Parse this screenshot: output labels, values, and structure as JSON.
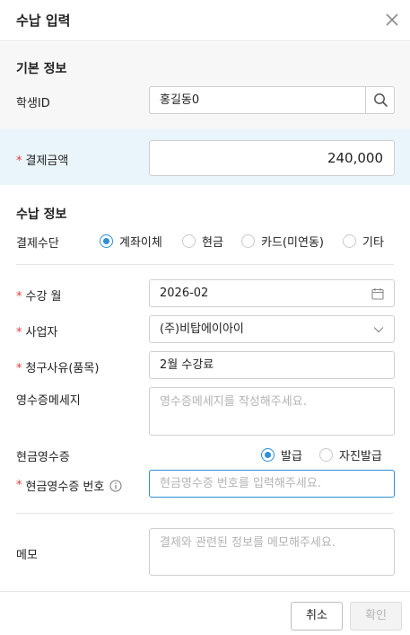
{
  "dialog": {
    "title": "수납 입력"
  },
  "basic": {
    "section_title": "기본 정보",
    "student_id_label": "학생ID",
    "student_id_value": "홍길동0"
  },
  "payment": {
    "label": "결제금액",
    "value": "240,000"
  },
  "receipt": {
    "section_title": "수납 정보",
    "method_label": "결제수단",
    "methods": [
      "계좌이체",
      "현금",
      "카드(미연동)",
      "기타"
    ],
    "selected_method": "계좌이체",
    "month_label": "수강 월",
    "month_value": "2026-02",
    "business_label": "사업자",
    "business_value": "(주)비탑에이아이",
    "reason_label": "청구사유(품목)",
    "reason_value": "2월 수강료",
    "message_label": "영수증메세지",
    "message_placeholder": "영수증메세지를 작성해주세요.",
    "cash_receipt_label": "현금영수증",
    "cash_receipt_options": [
      "발급",
      "자진발급"
    ],
    "cash_receipt_selected": "발급",
    "cash_number_label": "현금영수증 번호",
    "cash_number_placeholder": "현금영수증 번호를 입력해주세요."
  },
  "memo": {
    "label": "메모",
    "placeholder": "결제와 관련된 정보를 메모해주세요."
  },
  "footer": {
    "cancel_label": "취소",
    "confirm_label": "확인"
  },
  "colors": {
    "accent": "#2f8fd6",
    "required": "#e23b3b",
    "highlight_bg": "#eaf5fb",
    "section_bg": "#f7f7f8"
  },
  "icons": {
    "close": "close-icon",
    "search": "search-icon",
    "calendar": "calendar-icon",
    "chevron": "chevron-down-icon",
    "info": "info-icon"
  }
}
